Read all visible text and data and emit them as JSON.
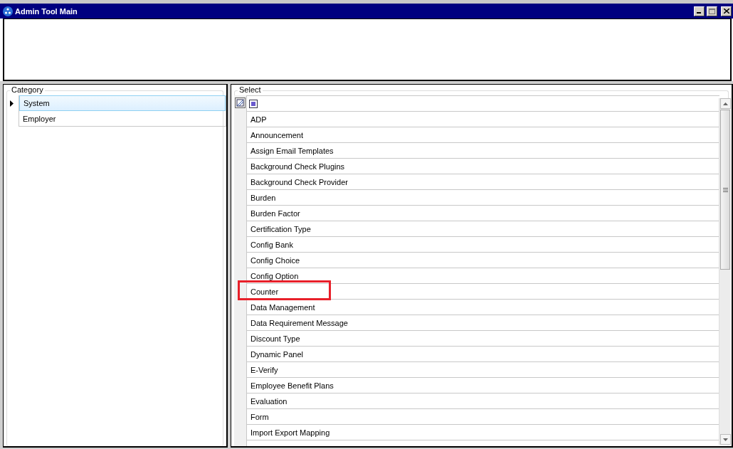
{
  "window": {
    "title": "Admin Tool Main"
  },
  "category": {
    "title": "Category",
    "items": [
      {
        "label": "System",
        "selected": true
      },
      {
        "label": "Employer",
        "selected": false
      }
    ]
  },
  "select": {
    "title": "Select",
    "items": [
      {
        "label": "ADP",
        "highlighted": false
      },
      {
        "label": "Announcement",
        "highlighted": false
      },
      {
        "label": "Assign Email Templates",
        "highlighted": false
      },
      {
        "label": "Background Check Plugins",
        "highlighted": false
      },
      {
        "label": "Background Check Provider",
        "highlighted": false
      },
      {
        "label": "Burden",
        "highlighted": false
      },
      {
        "label": "Burden Factor",
        "highlighted": false
      },
      {
        "label": "Certification Type",
        "highlighted": false
      },
      {
        "label": "Config Bank",
        "highlighted": false
      },
      {
        "label": "Config Choice",
        "highlighted": false
      },
      {
        "label": "Config Option",
        "highlighted": false
      },
      {
        "label": "Counter",
        "highlighted": true
      },
      {
        "label": "Data Management",
        "highlighted": false
      },
      {
        "label": "Data Requirement Message",
        "highlighted": false
      },
      {
        "label": "Discount Type",
        "highlighted": false
      },
      {
        "label": "Dynamic Panel",
        "highlighted": false
      },
      {
        "label": "E-Verify",
        "highlighted": false
      },
      {
        "label": "Employee Benefit Plans",
        "highlighted": false
      },
      {
        "label": "Evaluation",
        "highlighted": false
      },
      {
        "label": "Form",
        "highlighted": false
      },
      {
        "label": "Import Export Mapping",
        "highlighted": false
      }
    ]
  }
}
